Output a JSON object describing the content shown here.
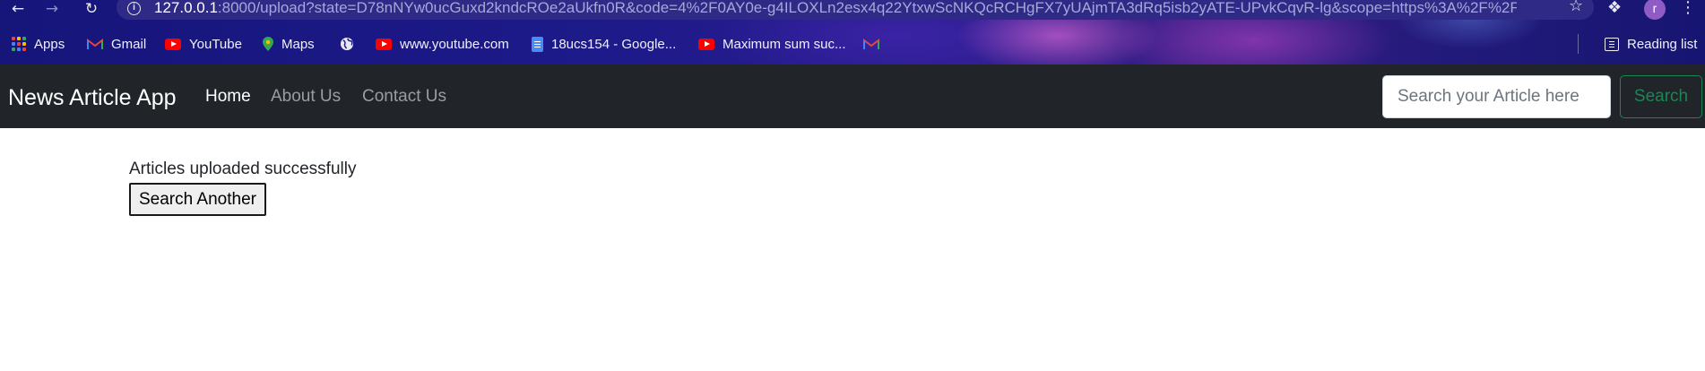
{
  "browser": {
    "back_icon": "arrow-left-icon",
    "forward_icon": "arrow-right-icon",
    "reload_icon": "reload-icon",
    "url_host": "127.0.0.1",
    "url_rest": ":8000/upload?state=D78nNYw0ucGuxd2kndcROe2aUkfn0R&code=4%2F0AY0e-g4ILOXLn2esx4q22YtxwScNKQcRCHgFX7yUAjmTA3dRq5isb2yATE-UPvkCqvR-lg&scope=https%3A%2F%2Fwww...",
    "profile_initial": "r"
  },
  "bookmarks": {
    "items": [
      {
        "label": "Apps",
        "icon": "apps-grid-icon"
      },
      {
        "label": "Gmail",
        "icon": "gmail-icon"
      },
      {
        "label": "YouTube",
        "icon": "youtube-icon"
      },
      {
        "label": "Maps",
        "icon": "maps-icon"
      },
      {
        "label": "",
        "icon": "globe-icon"
      },
      {
        "label": "www.youtube.com",
        "icon": "youtube-icon"
      },
      {
        "label": "18ucs154 - Google...",
        "icon": "google-docs-icon"
      },
      {
        "label": "Maximum sum suc...",
        "icon": "youtube-icon"
      },
      {
        "label": "",
        "icon": "gmail-icon"
      }
    ],
    "reading_list": "Reading list"
  },
  "navbar": {
    "brand": "News Article App",
    "links": [
      {
        "label": "Home",
        "active": true
      },
      {
        "label": "About Us",
        "active": false
      },
      {
        "label": "Contact Us",
        "active": false
      }
    ],
    "search_placeholder": "Search your Article here",
    "search_button": "Search"
  },
  "main": {
    "status_message": "Articles uploaded successfully",
    "search_another_label": "Search Another"
  },
  "colors": {
    "navbar_bg": "#212529",
    "success_green": "#198754",
    "chrome_bg": "#1d1a8a"
  }
}
